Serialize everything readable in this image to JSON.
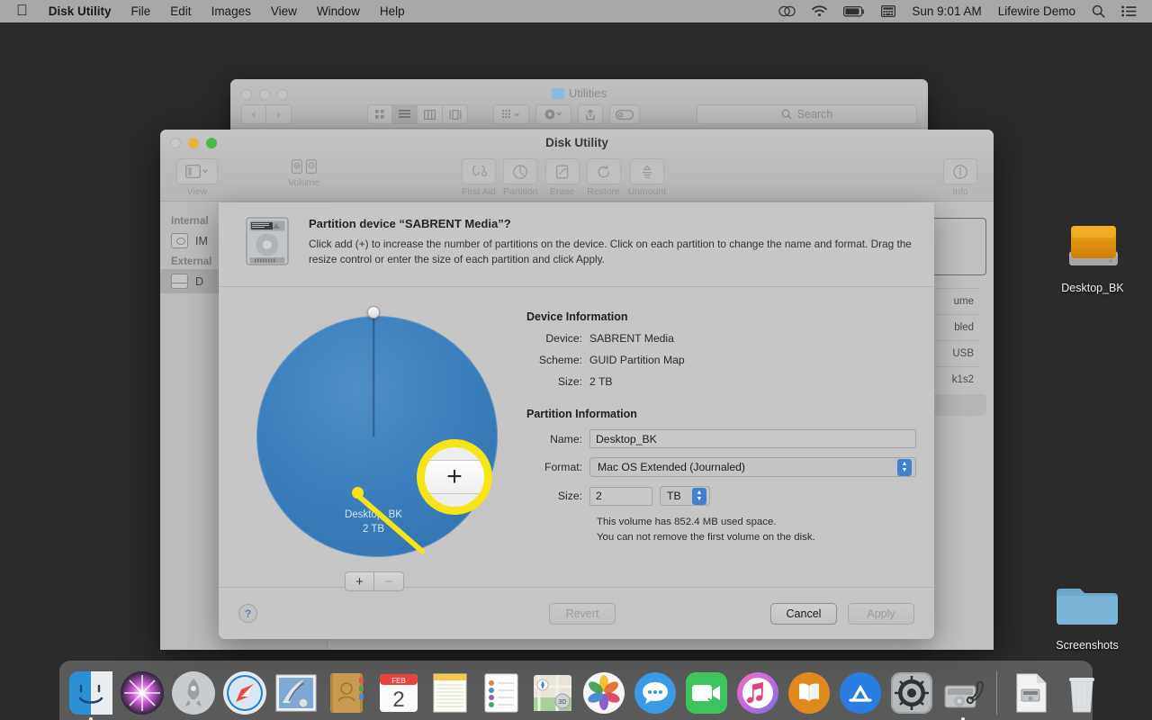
{
  "menubar": {
    "apple_icon": "apple-logo",
    "items": [
      {
        "label": "Disk Utility",
        "bold": true
      },
      {
        "label": "File",
        "bold": false
      },
      {
        "label": "Edit",
        "bold": false
      },
      {
        "label": "Images",
        "bold": false
      },
      {
        "label": "View",
        "bold": false
      },
      {
        "label": "Window",
        "bold": false
      },
      {
        "label": "Help",
        "bold": false
      }
    ],
    "status": {
      "cloud_icon": "cloud-sync-icon",
      "wifi_icon": "wifi-icon",
      "battery_icon": "battery-icon",
      "input_icon": "input-source-icon",
      "clock": "Sun 9:01 AM",
      "user": "Lifewire Demo",
      "search_icon": "spotlight-search-icon",
      "control_center_icon": "notification-center-icon"
    }
  },
  "desktop": {
    "icons": [
      {
        "name": "Desktop_BK",
        "type": "external-drive"
      },
      {
        "name": "Screenshots",
        "type": "folder"
      }
    ]
  },
  "finder_window": {
    "title": "Utilities",
    "nav": {
      "back": "‹",
      "forward": "›"
    },
    "view_modes": [
      "icon-view",
      "list-view",
      "column-view",
      "gallery-view"
    ],
    "toolbar_buttons": [
      "group-by",
      "action-gear",
      "share",
      "tag"
    ],
    "search_placeholder": "Search"
  },
  "disk_utility": {
    "title": "Disk Utility",
    "toolbar": [
      {
        "label": "View",
        "icon": "sidebar-view-icon"
      },
      {
        "label": "Volume",
        "icon": "volume-add-remove-icon"
      },
      {
        "label": "First Aid",
        "icon": "first-aid-icon"
      },
      {
        "label": "Partition",
        "icon": "partition-icon"
      },
      {
        "label": "Erase",
        "icon": "erase-icon"
      },
      {
        "label": "Restore",
        "icon": "restore-icon"
      },
      {
        "label": "Unmount",
        "icon": "unmount-icon"
      },
      {
        "label": "Info",
        "icon": "info-icon"
      }
    ],
    "sidebar": {
      "groups": [
        {
          "header": "Internal",
          "items": [
            {
              "label": "IM",
              "selected": false
            }
          ]
        },
        {
          "header": "External",
          "items": [
            {
              "label": "D",
              "selected": true
            }
          ]
        }
      ]
    },
    "info_rows": [
      "ume",
      "bled",
      "USB",
      "k1s2"
    ]
  },
  "sheet": {
    "title": "Partition device “SABRENT Media”?",
    "description": "Click add (+) to increase the number of partitions on the device. Click on each partition to change the name and format. Drag the resize control or enter the size of each partition and click Apply.",
    "device_icon": "hard-drive-icon",
    "pie": {
      "slice_label_name": "Desktop_BK",
      "slice_label_size": "2 TB",
      "color": "#3d80bd",
      "handle": "resize-handle"
    },
    "pie_buttons": {
      "add": "+",
      "remove": "−"
    },
    "magnifier": {
      "highlight_color": "#f5e518",
      "target": "add-partition-button",
      "glyph": "+"
    },
    "device_information": {
      "heading": "Device Information",
      "rows": [
        {
          "label": "Device:",
          "value": "SABRENT Media"
        },
        {
          "label": "Scheme:",
          "value": "GUID Partition Map"
        },
        {
          "label": "Size:",
          "value": "2 TB"
        }
      ]
    },
    "partition_information": {
      "heading": "Partition Information",
      "name_label": "Name:",
      "name_value": "Desktop_BK",
      "format_label": "Format:",
      "format_value": "Mac OS Extended (Journaled)",
      "size_label": "Size:",
      "size_value": "2",
      "size_unit": "TB",
      "note_line_1": "This volume has 852.4 MB used space.",
      "note_line_2": "You can not remove the first volume on the disk."
    },
    "footer": {
      "help": "?",
      "revert": "Revert",
      "cancel": "Cancel",
      "apply": "Apply"
    }
  },
  "dock": {
    "apps": [
      {
        "name": "Finder",
        "running": true
      },
      {
        "name": "Siri",
        "running": false
      },
      {
        "name": "Launchpad",
        "running": false
      },
      {
        "name": "Safari",
        "running": false
      },
      {
        "name": "Mail",
        "running": false
      },
      {
        "name": "Contacts",
        "running": false
      },
      {
        "name": "Calendar",
        "running": false,
        "badge_month": "FEB",
        "badge_day": "2"
      },
      {
        "name": "Notes",
        "running": false
      },
      {
        "name": "Reminders",
        "running": false
      },
      {
        "name": "Maps",
        "running": false
      },
      {
        "name": "Photos",
        "running": false
      },
      {
        "name": "Messages",
        "running": false
      },
      {
        "name": "FaceTime",
        "running": false
      },
      {
        "name": "iTunes",
        "running": false
      },
      {
        "name": "Books",
        "running": false
      },
      {
        "name": "App Store",
        "running": false
      },
      {
        "name": "System Preferences",
        "running": false
      },
      {
        "name": "Disk Utility",
        "running": true
      }
    ],
    "right_items": [
      {
        "name": "Downloads",
        "type": "stack"
      },
      {
        "name": "Trash",
        "type": "trash"
      }
    ]
  }
}
